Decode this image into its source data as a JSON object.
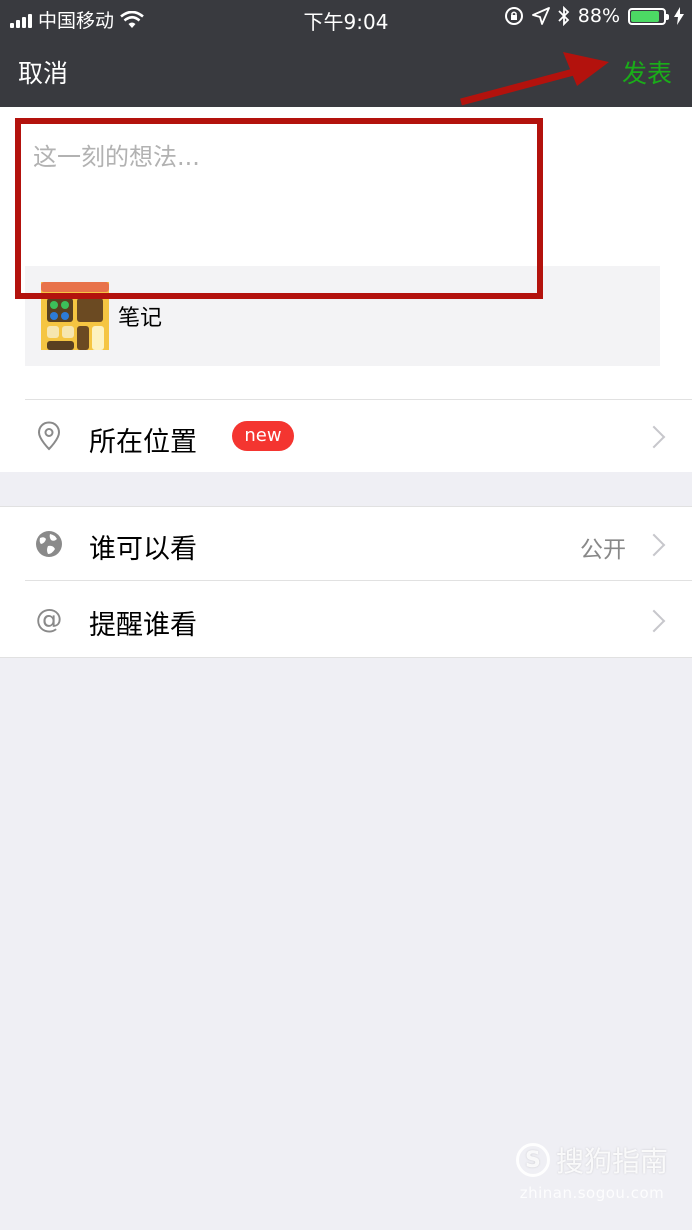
{
  "status_bar": {
    "carrier": "中国移动",
    "time": "下午9:04",
    "battery": "88%",
    "battery_level": 0.88
  },
  "nav": {
    "cancel": "取消",
    "publish": "发表"
  },
  "compose": {
    "placeholder": "这一刻的想法..."
  },
  "share": {
    "title": "笔记"
  },
  "location": {
    "label": "所在位置",
    "badge": "new"
  },
  "visibility": {
    "label": "谁可以看",
    "value": "公开"
  },
  "mention": {
    "label": "提醒谁看",
    "icon_text": "@"
  },
  "watermark": {
    "brand": "搜狗指南",
    "logo_letter": "S",
    "url": "zhinan.sogou.com"
  },
  "colors": {
    "nav_bg": "#393a3f",
    "publish_green": "#1aad19",
    "badge_red": "#f43530",
    "annotation_red": "#b3120d"
  }
}
